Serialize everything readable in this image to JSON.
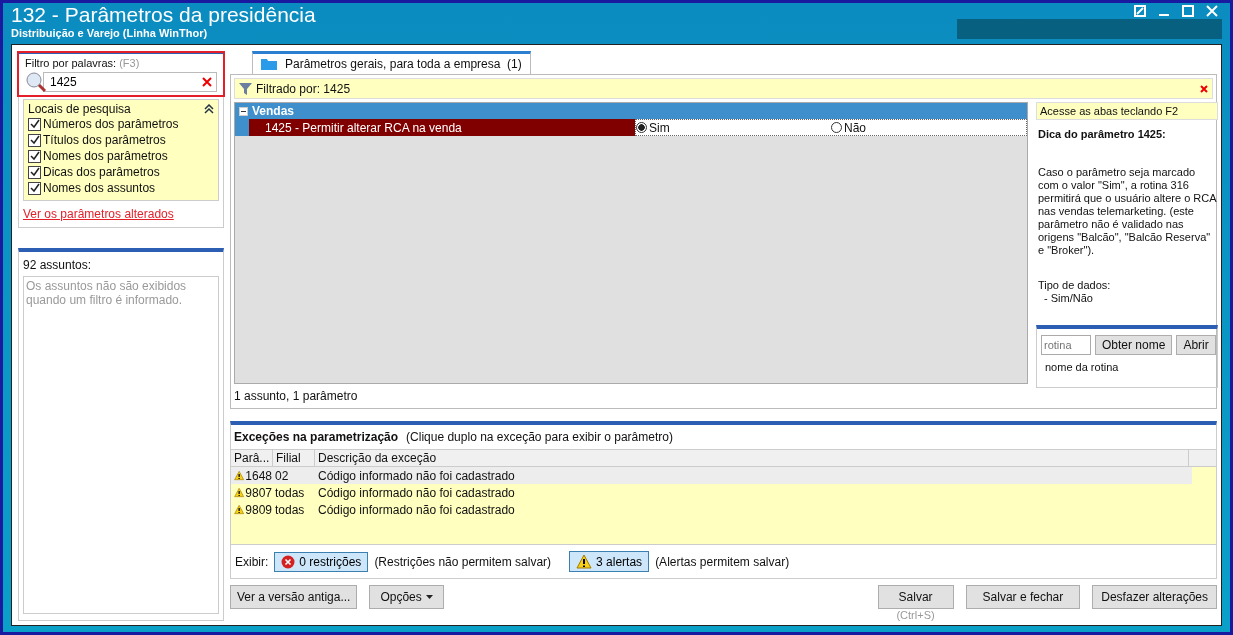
{
  "window": {
    "title": "132 - Parâmetros da presidência",
    "subtitle": "Distribuição e Varejo (Linha WinThor)"
  },
  "filter": {
    "label": "Filtro por palavras:",
    "shortcut": "(F3)",
    "value": "1425"
  },
  "search_locations": {
    "title": "Locais de pesquisa",
    "expanded": true,
    "options": [
      {
        "label": "Números dos parâmetros",
        "checked": true
      },
      {
        "label": "Títulos dos parâmetros",
        "checked": true
      },
      {
        "label": "Nomes dos parâmetros",
        "checked": true
      },
      {
        "label": "Dicas dos parâmetros",
        "checked": true
      },
      {
        "label": "Nomes dos assuntos",
        "checked": true
      }
    ]
  },
  "changed_link": "Ver os parâmetros alterados",
  "subjects": {
    "count_label": "92 assuntos:",
    "message": "Os assuntos não são exibidos quando um filtro é informado."
  },
  "tabs": [
    {
      "label": "Parâmetros gerais, para toda a empresa  (1)",
      "selected": true
    }
  ],
  "filter_bar": "Filtrado por: 1425",
  "groups": [
    {
      "title": "Vendas",
      "expanded": true,
      "params": [
        {
          "label": "1425 - Permitir alterar RCA na venda",
          "selected": true,
          "options": [
            {
              "label": "Sim",
              "selected": true
            },
            {
              "label": "Não",
              "selected": false
            }
          ]
        }
      ]
    }
  ],
  "summary": "1 assunto, 1 parâmetro",
  "hint_panel": {
    "shortcut_tip": "Acesse as abas teclando F2",
    "title": "Dica do parâmetro 1425:",
    "text": "Caso o parâmetro seja marcado com o valor \"Sim\", a rotina 316 permitirá que o usuário altere o RCA nas vendas telemarketing. (este parâmetro não é validado nas origens \"Balcão\", \"Balcão Reserva\" e \"Broker\").",
    "data_type_label": "Tipo de dados:",
    "data_type": "- Sim/Não",
    "routine_placeholder": "rotina",
    "get_name_button": "Obter nome",
    "open_button": "Abrir",
    "routine_name": "nome da rotina"
  },
  "exceptions": {
    "title": "Exceções na parametrização",
    "hint": "(Clique duplo na exceção para exibir o parâmetro)",
    "columns": [
      "Parâ...",
      "Filial",
      "Descrição da exceção"
    ],
    "rows": [
      {
        "param": "1648",
        "branch": "02",
        "description": "Código informado não foi cadastrado",
        "selected": true
      },
      {
        "param": "9807",
        "branch": "todas",
        "description": "Código informado não foi cadastrado",
        "selected": false
      },
      {
        "param": "9809",
        "branch": "todas",
        "description": "Código informado não foi cadastrado",
        "selected": false
      }
    ],
    "show_label": "Exibir:",
    "restrictions_button": "0 restrições",
    "restrictions_note": "(Restrições não permitem salvar)",
    "alerts_button": "3 alertas",
    "alerts_note": "(Alertas permitem salvar)"
  },
  "buttons": {
    "old_version": "Ver a versão antiga...",
    "options": "Opções",
    "save": "Salvar",
    "save_shortcut": "(Ctrl+S)",
    "save_close": "Salvar e fechar",
    "undo": "Desfazer alterações"
  }
}
